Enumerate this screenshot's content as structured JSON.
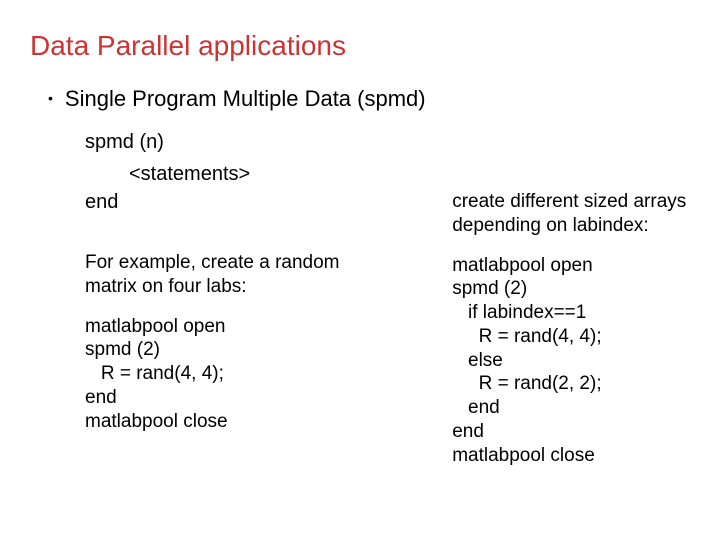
{
  "title": "Data Parallel applications",
  "bullet": "Single Program Multiple Data (spmd)",
  "syntax": {
    "line1": "spmd (n)",
    "line2": "<statements>",
    "line3": "end"
  },
  "left": {
    "intro": "For example, create a random matrix on four labs:",
    "code1": "matlabpool open",
    "code2": "spmd (2)",
    "code3": "   R = rand(4, 4);",
    "code4": "end",
    "code5": "matlabpool close"
  },
  "right": {
    "intro": "create different sized arrays depending on labindex:",
    "code1": "matlabpool open",
    "code2": "spmd (2)",
    "code3": "   if labindex==1",
    "code4": "     R = rand(4, 4);",
    "code5": "   else",
    "code6": "     R = rand(2, 2);",
    "code7": "   end",
    "code8": "end",
    "code9": "matlabpool close"
  }
}
